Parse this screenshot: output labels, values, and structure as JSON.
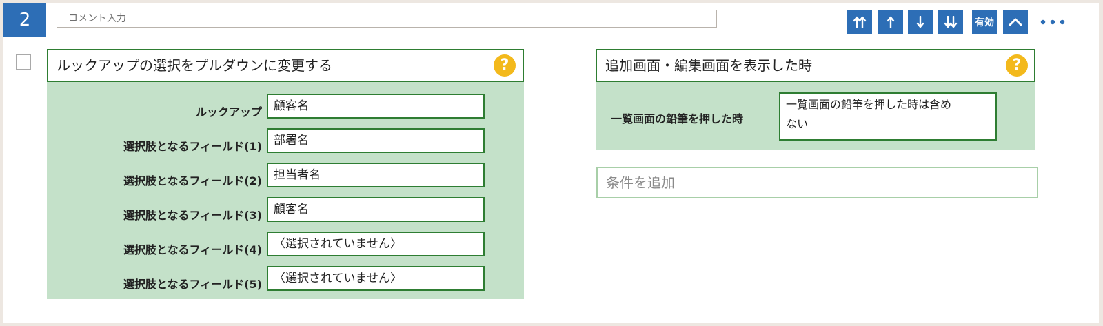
{
  "rule": {
    "number": "2",
    "comment_placeholder": "コメント入力"
  },
  "toolbar": {
    "move_top_icon": "double-arrow-up-icon",
    "move_up_icon": "arrow-up-icon",
    "move_down_icon": "arrow-down-icon",
    "move_bottom_icon": "double-arrow-down-icon",
    "enabled_label": "有効",
    "collapse_icon": "chevron-up-icon",
    "more_icon": "more-horizontal-icon"
  },
  "left_panel": {
    "title": "ルックアップの選択をプルダウンに変更する",
    "help_glyph": "?",
    "rows": [
      {
        "label": "ルックアップ",
        "value": "顧客名"
      },
      {
        "label": "選択肢となるフィールド(1)",
        "value": "部署名"
      },
      {
        "label": "選択肢となるフィールド(2)",
        "value": "担当者名"
      },
      {
        "label": "選択肢となるフィールド(3)",
        "value": "顧客名"
      },
      {
        "label": "選択肢となるフィールド(4)",
        "value": "〈選択されていません〉"
      },
      {
        "label": "選択肢となるフィールド(5)",
        "value": "〈選択されていません〉"
      }
    ]
  },
  "right_panel": {
    "title": "追加画面・編集画面を表示した時",
    "help_glyph": "?",
    "condition_label": "一覧画面の鉛筆を押した時",
    "condition_value_line1": "一覧画面の鉛筆を押した時は含め",
    "condition_value_line2": "ない",
    "add_condition": "条件を追加"
  },
  "colors": {
    "primary_blue": "#2d6eb6",
    "green_border": "#2e7d32",
    "green_fill": "#c4e1c9",
    "help_yellow": "#f3b91c"
  }
}
